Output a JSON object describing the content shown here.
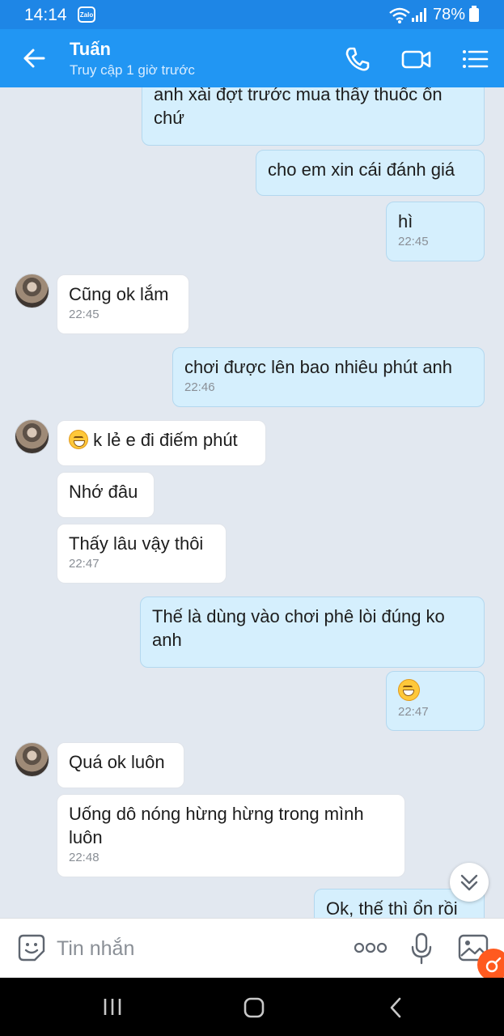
{
  "status_bar": {
    "time": "14:14",
    "app_badge": "Zalo",
    "battery": "78%"
  },
  "header": {
    "contact_name": "Tuấn",
    "last_seen": "Truy cập 1 giờ trước"
  },
  "messages": [
    {
      "dir": "out",
      "text": "anh xài đợt trước mua thấy thuốc ổn chứ"
    },
    {
      "dir": "out",
      "text": "cho em xin cái đánh giá"
    },
    {
      "dir": "out",
      "text": "hì",
      "time": "22:45"
    },
    {
      "dir": "in",
      "text": "Cũng ok lắm",
      "time": "22:45"
    },
    {
      "dir": "out",
      "text": "chơi được lên bao nhiêu phút anh",
      "time": "22:46"
    },
    {
      "dir": "in",
      "emoji": "grinning-sweat-emoji",
      "text": "k lẻ e đi điếm phút"
    },
    {
      "dir": "in",
      "text": "Nhớ đâu"
    },
    {
      "dir": "in",
      "text": "Thấy lâu vậy thôi",
      "time": "22:47"
    },
    {
      "dir": "out",
      "text": "Thế là dùng vào chơi phê lòi đúng ko anh"
    },
    {
      "dir": "out",
      "emoji": "grinning-emoji",
      "time": "22:47"
    },
    {
      "dir": "in",
      "text": "Quá ok luôn"
    },
    {
      "dir": "in",
      "text": "Uống dô nóng hừng hừng trong mình luôn",
      "time": "22:48"
    },
    {
      "dir": "out",
      "text": "Ok, thế thì ổn rồi"
    }
  ],
  "composer": {
    "placeholder": "Tin nhắn"
  },
  "icons": {
    "back": "back-arrow-icon",
    "call": "phone-icon",
    "video": "video-call-icon",
    "menu": "list-menu-icon",
    "sticker": "sticker-icon",
    "more": "more-dots-icon",
    "mic": "microphone-icon",
    "image": "image-icon",
    "scroll": "scroll-down-icon"
  },
  "colors": {
    "header": "#2196f3",
    "status_bar": "#1e86e6",
    "outgoing_bubble": "#d5effd",
    "incoming_bubble": "#ffffff",
    "chat_background": "#e2e8f0"
  }
}
